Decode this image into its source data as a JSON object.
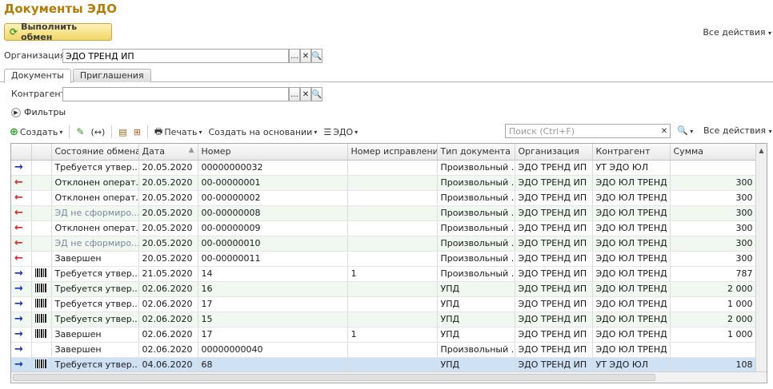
{
  "title": "Документы ЭДО",
  "exchange_button": "Выполнить обмен",
  "all_actions_top": "Все действия",
  "org_label": "Организация:",
  "org_value": "ЭДО ТРЕНД ИП",
  "tabs": [
    "Документы",
    "Приглашения"
  ],
  "counterparty_label": "Контрагент:",
  "counterparty_value": "",
  "filters_label": "Фильтры",
  "toolbar": {
    "create": "Создать",
    "print": "Печать",
    "create_based": "Создать на основании",
    "edo": "ЭДО",
    "search_placeholder": "Поиск (Ctrl+F)",
    "all_actions": "Все действия"
  },
  "columns": [
    "Состояние обмена",
    "Дата",
    "Номер",
    "Номер исправления",
    "Тип документа",
    "Организация",
    "Контрагент",
    "Сумма"
  ],
  "rows": [
    {
      "dir": "→",
      "state": "Требуется утвер...",
      "date": "20.05.2020",
      "number": "00000000032",
      "fix": "",
      "type": "Произвольный ...",
      "org": "ЭДО ТРЕНД ИП",
      "cp": "УТ ЭДО ЮЛ",
      "sum": ""
    },
    {
      "dir": "←",
      "state": "Отклонен операт...",
      "date": "20.05.2020",
      "number": "00-00000001",
      "fix": "",
      "type": "Произвольный ...",
      "org": "ЭДО ТРЕНД ИП",
      "cp": "ЭДО ЮЛ ТРЕНД",
      "sum": "300"
    },
    {
      "dir": "←",
      "state": "Отклонен операт...",
      "date": "20.05.2020",
      "number": "00-00000002",
      "fix": "",
      "type": "Произвольный ...",
      "org": "ЭДО ТРЕНД ИП",
      "cp": "ЭДО ЮЛ ТРЕНД",
      "sum": "300"
    },
    {
      "dir": "←",
      "state": "ЭД не сформиро...",
      "date": "20.05.2020",
      "number": "00-00000008",
      "fix": "",
      "type": "Произвольный ...",
      "org": "ЭДО ТРЕНД ИП",
      "cp": "ЭДО ЮЛ ТРЕНД",
      "sum": "300"
    },
    {
      "dir": "←",
      "state": "Отклонен операт...",
      "date": "20.05.2020",
      "number": "00-00000009",
      "fix": "",
      "type": "Произвольный ...",
      "org": "ЭДО ТРЕНД ИП",
      "cp": "ЭДО ЮЛ ТРЕНД",
      "sum": "300"
    },
    {
      "dir": "←",
      "state": "ЭД не сформиро...",
      "date": "20.05.2020",
      "number": "00-00000010",
      "fix": "",
      "type": "Произвольный ...",
      "org": "ЭДО ТРЕНД ИП",
      "cp": "ЭДО ЮЛ ТРЕНД",
      "sum": "300"
    },
    {
      "dir": "←",
      "state": "Завершен",
      "date": "20.05.2020",
      "number": "00-00000011",
      "fix": "",
      "type": "Произвольный ...",
      "org": "ЭДО ТРЕНД ИП",
      "cp": "ЭДО ЮЛ ТРЕНД",
      "sum": "300"
    },
    {
      "dir": "→",
      "state": "Требуется утвер...",
      "date": "21.05.2020",
      "number": "14",
      "fix": "1",
      "type": "Произвольный ...",
      "org": "ЭДО ТРЕНД ИП",
      "cp": "ЭДО ЮЛ ТРЕНД",
      "sum": "787"
    },
    {
      "dir": "→",
      "state": "Требуется утвер...",
      "date": "02.06.2020",
      "number": "16",
      "fix": "",
      "type": "УПД",
      "org": "ЭДО ТРЕНД ИП",
      "cp": "ЭДО ЮЛ ТРЕНД",
      "sum": "2 000"
    },
    {
      "dir": "→",
      "state": "Требуется утвер...",
      "date": "02.06.2020",
      "number": "17",
      "fix": "",
      "type": "УПД",
      "org": "ЭДО ТРЕНД ИП",
      "cp": "ЭДО ЮЛ ТРЕНД",
      "sum": "1 000"
    },
    {
      "dir": "→",
      "state": "Требуется утвер...",
      "date": "02.06.2020",
      "number": "15",
      "fix": "",
      "type": "УПД",
      "org": "ЭДО ТРЕНД ИП",
      "cp": "ЭДО ЮЛ ТРЕНД",
      "sum": "2 000"
    },
    {
      "dir": "→",
      "state": "Завершен",
      "date": "02.06.2020",
      "number": "17",
      "fix": "1",
      "type": "УПД",
      "org": "ЭДО ТРЕНД ИП",
      "cp": "ЭДО ЮЛ ТРЕНД",
      "sum": "1 000"
    },
    {
      "dir": "→",
      "state": "Завершен",
      "date": "02.06.2020",
      "number": "00000000040",
      "fix": "",
      "type": "Произвольный ...",
      "org": "ЭДО ТРЕНД ИП",
      "cp": "ЭДО ЮЛ ТРЕНД",
      "sum": ""
    },
    {
      "dir": "→",
      "state": "Требуется утвер...",
      "date": "04.06.2020",
      "number": "68",
      "fix": "",
      "type": "УПД",
      "org": "ЭДО ТРЕНД ИП",
      "cp": "УТ ЭДО ЮЛ",
      "sum": "108"
    }
  ]
}
